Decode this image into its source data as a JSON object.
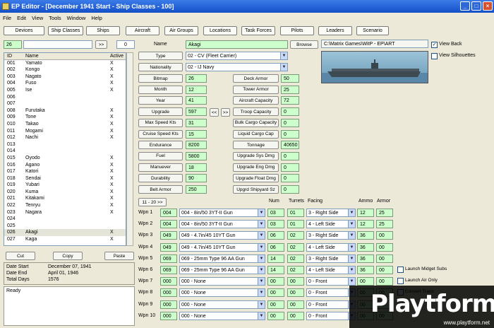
{
  "window": {
    "title": "EP Editor - [December 1941 Start - Ship Classes - 100]"
  },
  "menu": [
    "File",
    "Edit",
    "View",
    "Tools",
    "Window",
    "Help"
  ],
  "nav": [
    "Devices",
    "Ship Classes",
    "Ships",
    "Aircraft",
    "Air Groups",
    "Locations",
    "Task Forces",
    "Pilots",
    "Leaders",
    "Scenario"
  ],
  "search": {
    "id": "26",
    "text": "",
    "goto": ">>",
    "count": "0"
  },
  "list": {
    "headers": [
      "ID",
      "Name",
      "Active"
    ],
    "rows": [
      [
        "001",
        "Yamato",
        "X"
      ],
      [
        "002",
        "Kongo",
        "X"
      ],
      [
        "003",
        "Nagato",
        "X"
      ],
      [
        "004",
        "Fuso",
        "X"
      ],
      [
        "005",
        "Ise",
        "X"
      ],
      [
        "006",
        "",
        ""
      ],
      [
        "007",
        "",
        ""
      ],
      [
        "008",
        "Furutaka",
        "X"
      ],
      [
        "009",
        "Tone",
        "X"
      ],
      [
        "010",
        "Takao",
        "X"
      ],
      [
        "011",
        "Mogami",
        "X"
      ],
      [
        "012",
        "Nachi",
        "X"
      ],
      [
        "013",
        "",
        ""
      ],
      [
        "014",
        "",
        ""
      ],
      [
        "015",
        "Oyodo",
        "X"
      ],
      [
        "016",
        "Agano",
        "X"
      ],
      [
        "017",
        "Katori",
        "X"
      ],
      [
        "018",
        "Sendai",
        "X"
      ],
      [
        "019",
        "Yubari",
        "X"
      ],
      [
        "020",
        "Kuma",
        "X"
      ],
      [
        "021",
        "Kitakami",
        "X"
      ],
      [
        "022",
        "Tenryu",
        "X"
      ],
      [
        "023",
        "Nagara",
        "X"
      ],
      [
        "024",
        "",
        ""
      ],
      [
        "025",
        "",
        ""
      ],
      [
        "026",
        "Akagi",
        "X"
      ],
      [
        "027",
        "Kaga",
        "X"
      ]
    ]
  },
  "clip": {
    "cut": "Cut",
    "copy": "Copy",
    "paste": "Paste"
  },
  "info": {
    "start_label": "Date Start",
    "start": "December 07, 1941",
    "end_label": "Date End",
    "end": "April 01, 1946",
    "days_label": "Total Days",
    "days": "1576"
  },
  "status": "Ready",
  "form": {
    "name_label": "Name",
    "name": "Akagi",
    "browse": "Browse",
    "path": "C:\\Matrix Games\\WitP - EP\\ART",
    "view_back": "View Back",
    "view_silhouettes": "View Silhouettes",
    "type_label": "Type",
    "type": "02 - CV (Fleet Carrier)",
    "nat_label": "Nationality",
    "nat": "02 - IJ Navy",
    "left": [
      [
        "Bitmap",
        "26"
      ],
      [
        "Month",
        "12"
      ],
      [
        "Year",
        "41"
      ],
      [
        "Upgrade",
        "597"
      ],
      [
        "Max Speed Kts",
        "31"
      ],
      [
        "Cruise Speed Kts",
        "15"
      ],
      [
        "Endurance",
        "8200"
      ],
      [
        "Fuel",
        "5800"
      ],
      [
        "Manuever",
        "18"
      ],
      [
        "Durability",
        "90"
      ],
      [
        "Belt Armor",
        "250"
      ]
    ],
    "arrows": [
      "<<",
      ">>"
    ],
    "right": [
      [
        "Deck Armor",
        "50"
      ],
      [
        "Tower Armor",
        "25"
      ],
      [
        "Aircraft Capacity",
        "72"
      ],
      [
        "Troop Capacity",
        "0"
      ],
      [
        "Bulk Cargo Capacity",
        "0"
      ],
      [
        "Liquid Cargo Cap",
        "0"
      ],
      [
        "Tonnage",
        "40650"
      ],
      [
        "Upgrade Sys Dmg",
        "0"
      ],
      [
        "Upgrade Eng Dmg",
        "0"
      ],
      [
        "Upgrade Float Dmg",
        "0"
      ],
      [
        "Upgrd Shipyard Sz",
        "0"
      ]
    ],
    "page_btn": "11 - 20 >>"
  },
  "weapons": {
    "headers": [
      "Num",
      "Turrets",
      "Facing",
      "Ammo",
      "Armor"
    ],
    "rows": [
      [
        "Wpn 1",
        "004",
        "004 - 8in/50 3YT-II Gun",
        "03",
        "01",
        "3 - Right Side",
        "12",
        "25"
      ],
      [
        "Wpn 2",
        "004",
        "004 - 8in/50 3YT-II Gun",
        "03",
        "01",
        "4 - Left Side",
        "12",
        "25"
      ],
      [
        "Wpn 3",
        "049",
        "049 - 4.7in/45 10YT Gun",
        "06",
        "02",
        "3 - Right Side",
        "36",
        "00"
      ],
      [
        "Wpn 4",
        "049",
        "049 - 4.7in/45 10YT Gun",
        "06",
        "02",
        "4 - Left Side",
        "36",
        "00"
      ],
      [
        "Wpn 5",
        "069",
        "069 - 25mm Type 96 AA Gun",
        "14",
        "02",
        "3 - Right Side",
        "36",
        "00"
      ],
      [
        "Wpn 6",
        "069",
        "069 - 25mm Type 96 AA Gun",
        "14",
        "02",
        "4 - Left Side",
        "36",
        "00"
      ],
      [
        "Wpn 7",
        "000",
        "000 - None",
        "00",
        "00",
        "0 - Front",
        "00",
        "00"
      ],
      [
        "Wpn 8",
        "000",
        "000 - None",
        "00",
        "00",
        "0 - Front",
        "00",
        "00"
      ],
      [
        "Wpn 9",
        "000",
        "000 - None",
        "00",
        "00",
        "0 - Front",
        "00",
        "00"
      ],
      [
        "Wpn 10",
        "000",
        "000 - None",
        "00",
        "00",
        "0 - Front",
        "00",
        "00"
      ]
    ],
    "opts": [
      "Launch Midget Subs",
      "Launch Air Only",
      "Convert Trans"
    ]
  },
  "watermark": {
    "brand": "Playtform",
    "url": "www.playtform.net"
  }
}
